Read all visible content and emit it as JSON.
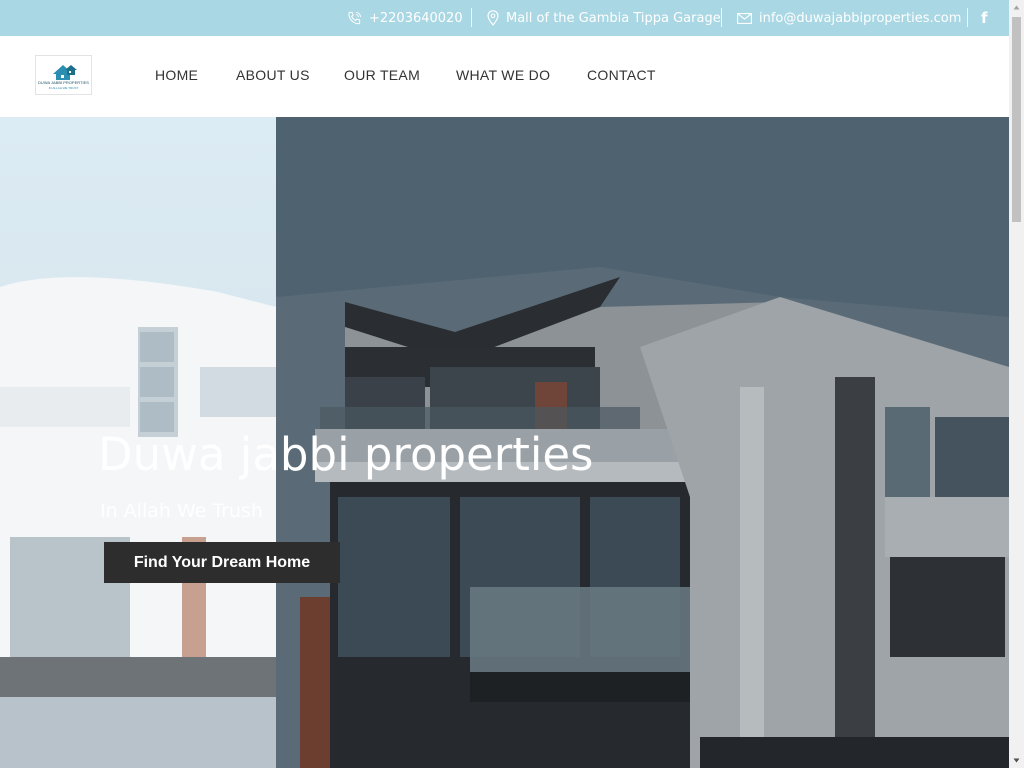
{
  "topbar": {
    "phone": "+2203640020",
    "address": "Mall of the Gambia Tippa Garage",
    "email": "info@duwajabbiproperties.com",
    "facebook_glyph": "f",
    "icons": [
      "phone-icon",
      "location-pin-icon",
      "envelope-icon",
      "facebook-icon"
    ],
    "background_color": "#a9d7e3"
  },
  "logo": {
    "text_line1": "DUWA JABBI PROPERTIES",
    "text_line2": "IN ALLAH WE TRUST"
  },
  "nav": {
    "items": [
      {
        "label": "HOME"
      },
      {
        "label": "ABOUT US"
      },
      {
        "label": "OUR TEAM"
      },
      {
        "label": "WHAT WE DO"
      },
      {
        "label": "CONTACT"
      }
    ]
  },
  "hero": {
    "title": "Duwa jabbi properties",
    "subtitle": "In Allah We Trush",
    "cta_label": "Find Your Dream Home",
    "button_color": "#2d2d2d"
  }
}
